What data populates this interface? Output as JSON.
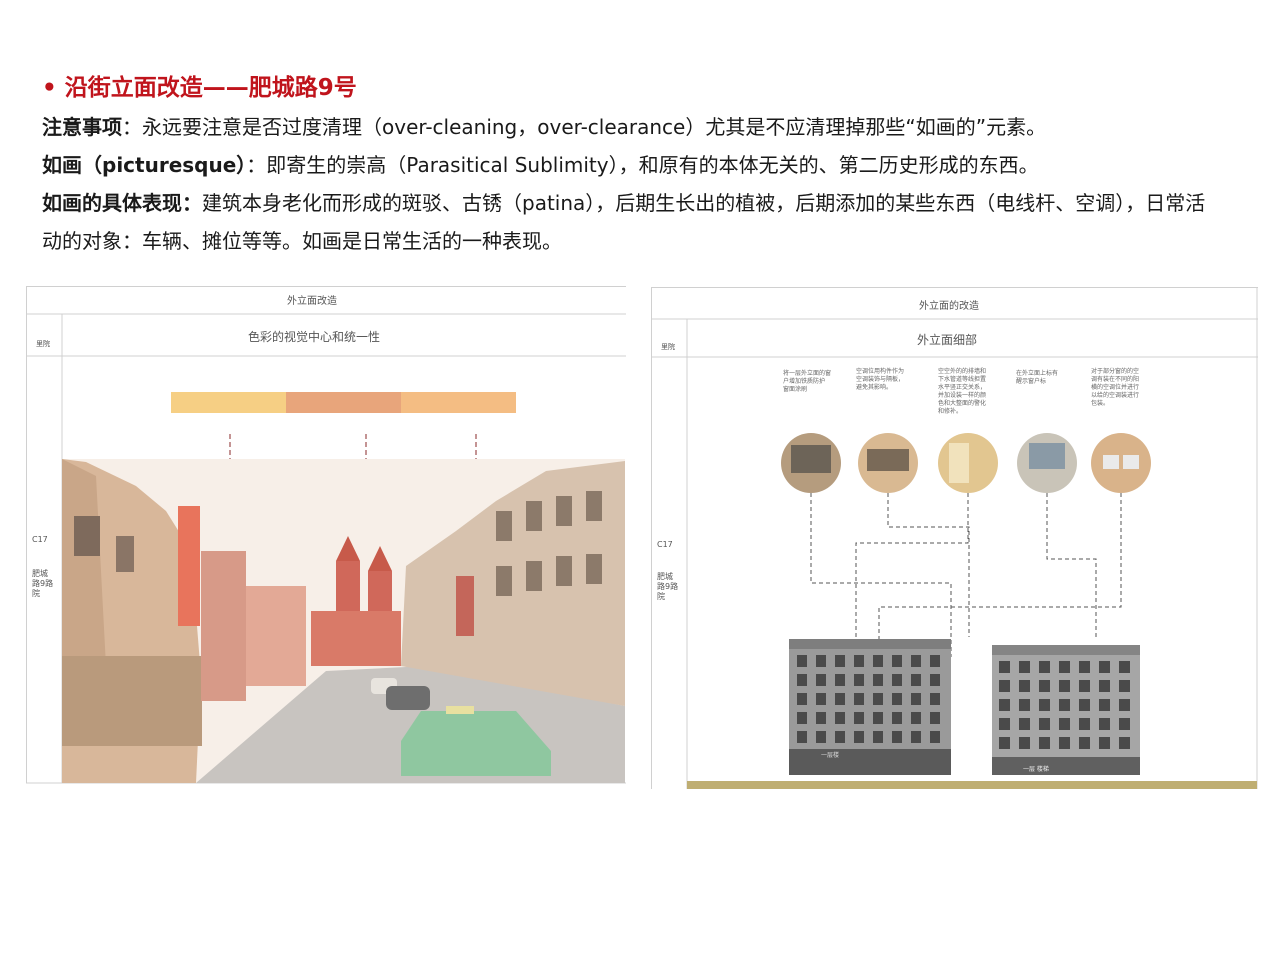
{
  "heading": {
    "bullet": "•",
    "title": "沿街立面改造——肥城路9号"
  },
  "paragraphs": [
    {
      "label": "注意事项",
      "text": "：永远要注意是否过度清理（over-cleaning，over-clearance）尤其是不应清理掉那些“如画的”元素。"
    },
    {
      "label": "如画（picturesque）",
      "text": "：即寄生的崇高（Parasitical Sublimity），和原有的本体无关的、第二历史形成的东西。"
    },
    {
      "label": "如画的具体表现：",
      "text": "建筑本身老化而形成的斑驳、古锈（patina），后期生长出的植被，后期添加的某些东西（电线杆、空调），日常活动的对象：车辆、摊位等等。如画是日常生活的一种表现。"
    }
  ],
  "left_panel": {
    "header": "外立面改造",
    "row_label": "里院",
    "subtitle": "色彩的视觉中心和统一性",
    "code": "C17",
    "address": [
      "肥城",
      "路9路",
      "院"
    ],
    "swatches": [
      "#f6cf84",
      "#e8a57b",
      "#f4bd83"
    ]
  },
  "right_panel": {
    "header": "外立面的改造",
    "row_label": "里院",
    "subtitle": "外立面细部",
    "code": "C17",
    "address": [
      "肥城",
      "路9路",
      "院"
    ],
    "annotations": [
      [
        "将一层外立面的窗",
        "户增加铁质防护",
        "窗面涂刷"
      ],
      [
        "空调位用构件作为",
        "空调装饰与隔板，",
        "避免其影响。"
      ],
      [
        "空空外的的排墙和",
        "下水管道等线担置",
        "水平竖正交关系，",
        "并加设装一样的颜",
        "色和大整面的警化",
        "和修补。"
      ],
      [
        "在外立面上标有",
        "醒示窗户标"
      ],
      [
        "对于部分窗的的空",
        "调有装在不同的阳",
        "横的空调位并进行",
        "以给的空调装进行",
        "包装。"
      ]
    ],
    "shop_sign_a": "一层楼",
    "shop_sign_b": "一层 楼梯"
  }
}
